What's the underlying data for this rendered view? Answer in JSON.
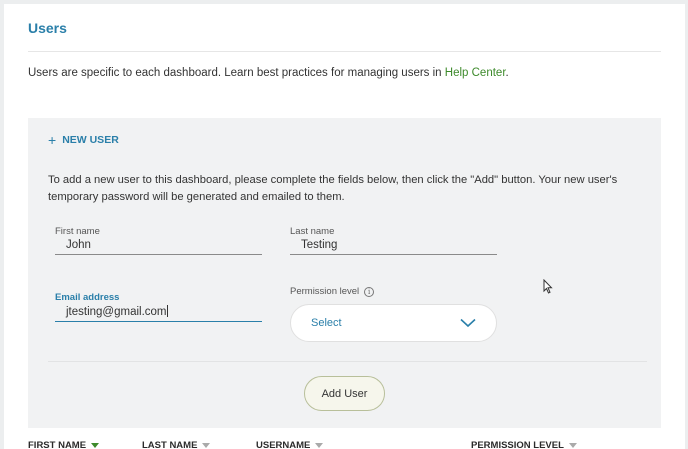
{
  "page": {
    "title": "Users",
    "intro_text": "Users are specific to each dashboard. Learn best practices for managing users in ",
    "help_link": "Help Center",
    "intro_end": "."
  },
  "new_user": {
    "label": "NEW USER",
    "description": "To add a new user to this dashboard, please complete the fields below, then click the \"Add\" button. Your new user's temporary password will be generated and emailed to them.",
    "first_name": {
      "label": "First name",
      "value": "John"
    },
    "last_name": {
      "label": "Last name",
      "value": "Testing"
    },
    "email": {
      "label": "Email address",
      "value": "jtesting@gmail.com"
    },
    "permission": {
      "label": "Permission level",
      "selected": "Select"
    },
    "add_button": "Add User"
  },
  "table": {
    "columns": [
      "FIRST NAME",
      "LAST NAME",
      "USERNAME",
      "PERMISSION LEVEL"
    ]
  },
  "colors": {
    "accent": "#2a7fa9",
    "link": "#3d8a2b",
    "panel": "#f1f2f3"
  }
}
